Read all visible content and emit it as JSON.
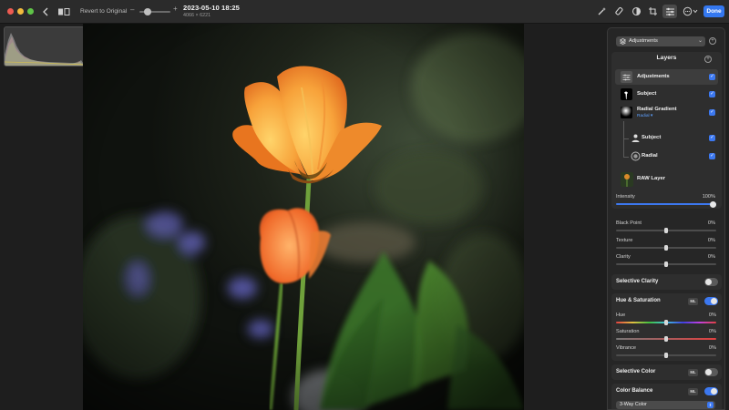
{
  "toolbar": {
    "revert_label": "Revert to Original",
    "zoom_min": "–",
    "zoom_max": "+",
    "title": "2023-05-10 18:25",
    "subtitle": "4066 × 6221",
    "done_label": "Done",
    "icons": [
      "back-icon",
      "split-view-icon",
      "magic-wand-icon",
      "retouch-icon",
      "red-eye-icon",
      "crop-icon",
      "adjust-icon",
      "more-icon"
    ]
  },
  "panel": {
    "adjustments_select": "Adjustments",
    "layers": {
      "title": "Layers",
      "items": [
        {
          "label": "Adjustments",
          "sub": "",
          "checked": true
        },
        {
          "label": "Subject",
          "sub": "",
          "checked": true
        },
        {
          "label": "Radial Gradient",
          "sub": "Radial ▾",
          "checked": true
        },
        {
          "label": "Subject",
          "sub": "",
          "checked": true
        },
        {
          "label": "Radial",
          "sub": "",
          "checked": true
        },
        {
          "label": "RAW Layer",
          "sub": "",
          "checked": false
        }
      ]
    },
    "intensity": {
      "label": "Intensity",
      "value": "100%"
    },
    "sliders": [
      {
        "label": "Black Point",
        "value": "0%"
      },
      {
        "label": "Texture",
        "value": "0%"
      },
      {
        "label": "Clarity",
        "value": "0%"
      }
    ],
    "selective_clarity": {
      "title": "Selective Clarity",
      "on": false
    },
    "hue_saturation": {
      "title": "Hue & Saturation",
      "ml": "ML",
      "on": true,
      "sliders": [
        {
          "label": "Hue",
          "value": "0%"
        },
        {
          "label": "Saturation",
          "value": "0%"
        },
        {
          "label": "Vibrance",
          "value": "0%"
        }
      ]
    },
    "selective_color": {
      "title": "Selective Color",
      "ml": "ML",
      "on": false
    },
    "color_balance": {
      "title": "Color Balance",
      "ml": "ML",
      "on": true,
      "mode": "3-Way Color"
    }
  },
  "colors": {
    "accent": "#3c78f0",
    "done": "#3478f0"
  }
}
